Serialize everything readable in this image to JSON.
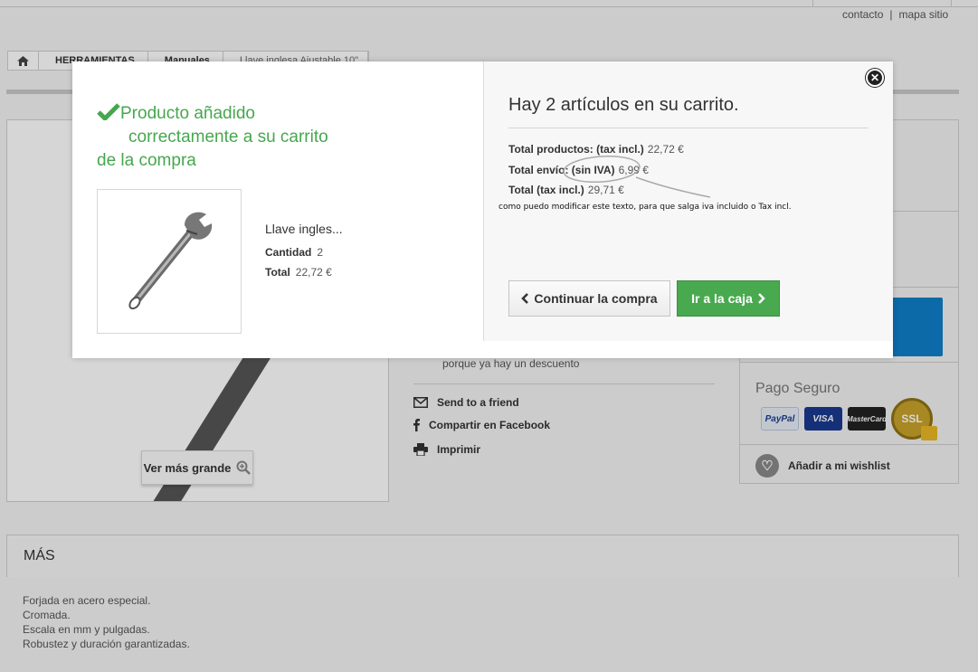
{
  "header": {
    "links": [
      "contacto",
      "mapa sitio"
    ]
  },
  "breadcrumb": {
    "home_icon": "home-icon",
    "items": [
      "HERRAMIENTAS",
      "Manuales",
      "Llave inglesa Ajustable 10\""
    ]
  },
  "product_page": {
    "zoom_label": "Ver más grande",
    "discount_note": "porque ya hay un descuento",
    "actions": [
      {
        "label": "Send to a friend",
        "icon": "envelope-icon"
      },
      {
        "label": "Compartir en Facebook",
        "icon": "facebook-icon"
      },
      {
        "label": "Imprimir",
        "icon": "printer-icon"
      }
    ],
    "secure_payment_label": "Pago Seguro",
    "payment_cards": [
      "PayPal",
      "VISA",
      "MasterCard",
      "SSL"
    ],
    "wishlist_label": "Añadir a mi wishlist",
    "more_section_title": "MÁS",
    "description_lines": [
      "Forjada en acero especial.",
      "Cromada.",
      "Escala en mm y pulgadas.",
      "Robustez y duración garantizadas."
    ]
  },
  "modal": {
    "success_message": {
      "line1": "Producto añadido",
      "line2": "correctamente a su carrito",
      "line3": "de la compra"
    },
    "product": {
      "name": "Llave ingles...",
      "quantity_label": "Cantidad",
      "quantity": "2",
      "total_label": "Total",
      "total": "22,72 €"
    },
    "cart": {
      "title": "Hay 2 artículos en su carrito.",
      "rows": [
        {
          "label": "Total productos: (tax incl.)",
          "value": "22,72 €"
        },
        {
          "label": "Total envío: (sin IVA)",
          "value": "6,99 €"
        },
        {
          "label": "Total (tax incl.)",
          "value": "29,71 €"
        }
      ],
      "annotation": "como puedo modificar este texto, para que salga iva incluido o Tax incl.",
      "continue_label": "Continuar la compra",
      "checkout_label": "Ir a la caja"
    },
    "close_icon": "close-icon"
  },
  "colors": {
    "success_green": "#46a74e",
    "checkout_button": "#49a94f",
    "accent_blue": "#0e7fc7"
  }
}
